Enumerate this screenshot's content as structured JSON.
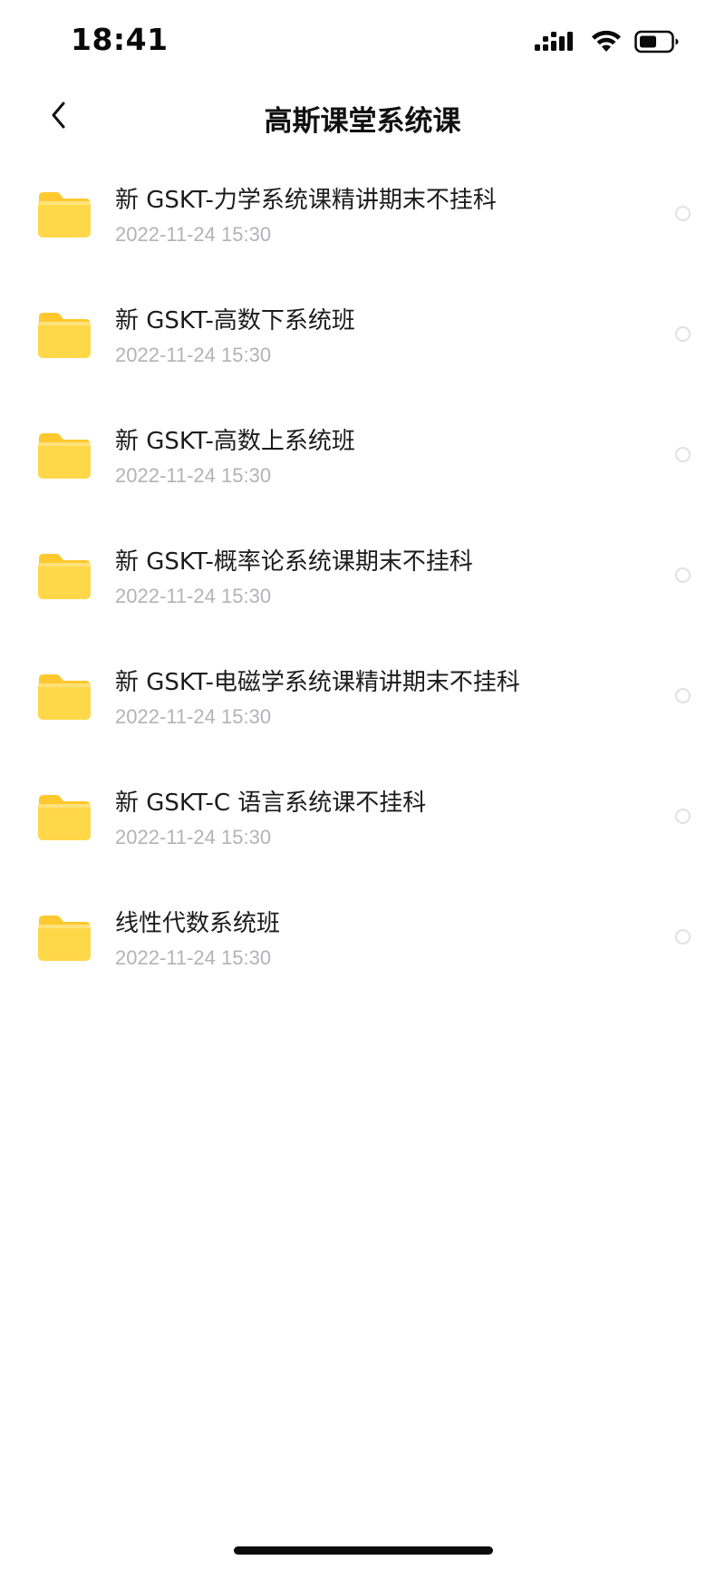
{
  "status_bar": {
    "time": "18:41",
    "icons": [
      "cellular-signal-icon",
      "wifi-icon",
      "battery-icon"
    ]
  },
  "nav": {
    "title": "高斯课堂系统课",
    "back_icon": "chevron-left-icon"
  },
  "files": [
    {
      "name": "新 GSKT-力学系统课精讲期末不挂科",
      "date": "2022-11-24 15:30"
    },
    {
      "name": "新 GSKT-高数下系统班",
      "date": "2022-11-24 15:30"
    },
    {
      "name": "新 GSKT-高数上系统班",
      "date": "2022-11-24 15:30"
    },
    {
      "name": "新 GSKT-概率论系统课期末不挂科",
      "date": "2022-11-24 15:30"
    },
    {
      "name": "新 GSKT-电磁学系统课精讲期末不挂科",
      "date": "2022-11-24 15:30"
    },
    {
      "name": "新 GSKT-C 语言系统课不挂科",
      "date": "2022-11-24 15:30"
    },
    {
      "name": "线性代数系统班",
      "date": "2022-11-24 15:30"
    }
  ],
  "colors": {
    "folder_fill": "#FFD84A",
    "folder_tab": "#FFC82E",
    "date_text": "#B3B3B8",
    "radio_border": "#E1E1E4"
  }
}
